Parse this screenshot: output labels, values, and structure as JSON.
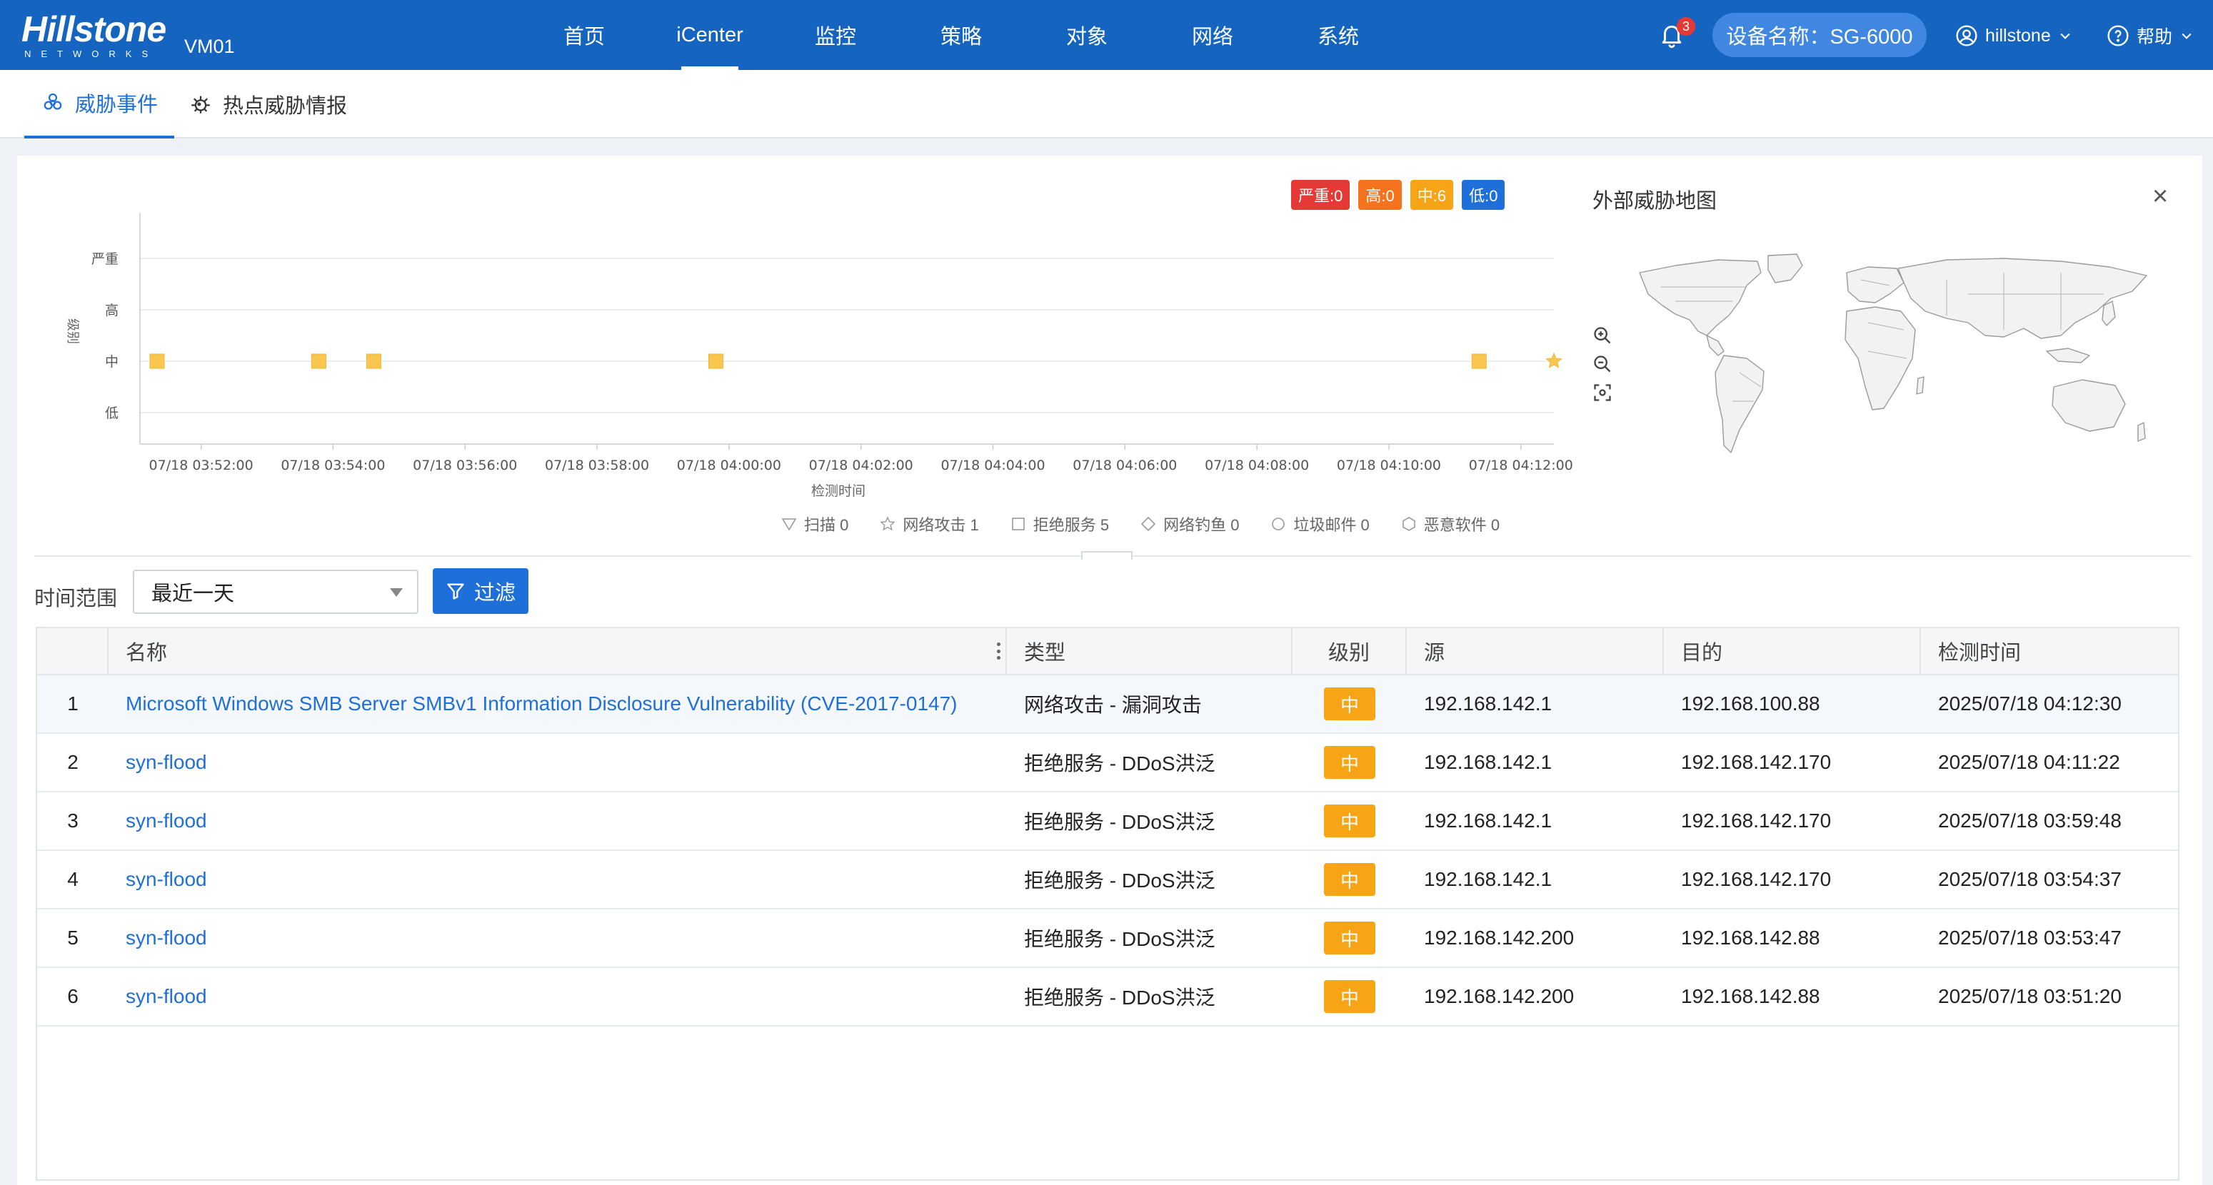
{
  "header": {
    "logo_text": "Hillstone",
    "logo_sub": "NETWORKS",
    "device_short": "VM01",
    "nav": [
      {
        "label": "首页"
      },
      {
        "label": "iCenter"
      },
      {
        "label": "监控"
      },
      {
        "label": "策略"
      },
      {
        "label": "对象"
      },
      {
        "label": "网络"
      },
      {
        "label": "系统"
      }
    ],
    "active_nav": "iCenter",
    "notification_count": "3",
    "device_name": "设备名称：SG-6000",
    "user": "hillstone",
    "help": "帮助",
    "brand_color": "#1565c0"
  },
  "tabs": [
    {
      "label": "威胁事件",
      "icon": "biohazard-icon",
      "active": true
    },
    {
      "label": "热点威胁情报",
      "icon": "virus-icon",
      "active": false
    }
  ],
  "severity_badges": [
    {
      "label": "严重:0",
      "color": "#e53935"
    },
    {
      "label": "高:0",
      "color": "#f4731c"
    },
    {
      "label": "中:6",
      "color": "#f7a416"
    },
    {
      "label": "低:0",
      "color": "#1e6fd9"
    }
  ],
  "chart_data": {
    "type": "scatter",
    "ylabel": "级别",
    "xlabel": "检测时间",
    "y_categories": [
      "低",
      "中",
      "高",
      "严重"
    ],
    "x_ticks": [
      "07/18 03:52:00",
      "07/18 03:54:00",
      "07/18 03:56:00",
      "07/18 03:58:00",
      "07/18 04:00:00",
      "07/18 04:02:00",
      "07/18 04:04:00",
      "07/18 04:06:00",
      "07/18 04:08:00",
      "07/18 04:10:00",
      "07/18 04:12:00"
    ],
    "xlim": [
      "07/18 03:51:20",
      "07/18 04:12:30"
    ],
    "series": [
      {
        "name": "拒绝服务",
        "marker": "square",
        "color": "#f9c74f",
        "points": [
          {
            "x": "07/18 03:51:20",
            "y": "中"
          },
          {
            "x": "07/18 03:53:47",
            "y": "中"
          },
          {
            "x": "07/18 03:54:37",
            "y": "中"
          },
          {
            "x": "07/18 03:59:48",
            "y": "中"
          },
          {
            "x": "07/18 04:11:22",
            "y": "中"
          }
        ]
      },
      {
        "name": "网络攻击",
        "marker": "star",
        "color": "#f9c74f",
        "points": [
          {
            "x": "07/18 04:12:30",
            "y": "中"
          }
        ]
      }
    ],
    "legend": [
      {
        "label": "扫描 0",
        "shape": "triangle-down"
      },
      {
        "label": "网络攻击 1",
        "shape": "star"
      },
      {
        "label": "拒绝服务 5",
        "shape": "square"
      },
      {
        "label": "网络钓鱼 0",
        "shape": "diamond"
      },
      {
        "label": "垃圾邮件 0",
        "shape": "circle"
      },
      {
        "label": "恶意软件 0",
        "shape": "hexagon"
      }
    ]
  },
  "map": {
    "title": "外部威胁地图",
    "close": "×"
  },
  "filter": {
    "label": "时间范围",
    "value": "最近一天",
    "button": "过滤"
  },
  "table": {
    "headers": [
      "名称",
      "类型",
      "级别",
      "源",
      "目的",
      "检测时间"
    ],
    "rows": [
      {
        "idx": "1",
        "name": "Microsoft Windows SMB Server SMBv1 Information Disclosure Vulnerability (CVE-2017-0147)",
        "type": "网络攻击 - 漏洞攻击",
        "level": "中",
        "src": "192.168.142.1",
        "dst": "192.168.100.88",
        "time": "2025/07/18 04:12:30"
      },
      {
        "idx": "2",
        "name": "syn-flood",
        "type": "拒绝服务 - DDoS洪泛",
        "level": "中",
        "src": "192.168.142.1",
        "dst": "192.168.142.170",
        "time": "2025/07/18 04:11:22"
      },
      {
        "idx": "3",
        "name": "syn-flood",
        "type": "拒绝服务 - DDoS洪泛",
        "level": "中",
        "src": "192.168.142.1",
        "dst": "192.168.142.170",
        "time": "2025/07/18 03:59:48"
      },
      {
        "idx": "4",
        "name": "syn-flood",
        "type": "拒绝服务 - DDoS洪泛",
        "level": "中",
        "src": "192.168.142.1",
        "dst": "192.168.142.170",
        "time": "2025/07/18 03:54:37"
      },
      {
        "idx": "5",
        "name": "syn-flood",
        "type": "拒绝服务 - DDoS洪泛",
        "level": "中",
        "src": "192.168.142.200",
        "dst": "192.168.142.88",
        "time": "2025/07/18 03:53:47"
      },
      {
        "idx": "6",
        "name": "syn-flood",
        "type": "拒绝服务 - DDoS洪泛",
        "level": "中",
        "src": "192.168.142.200",
        "dst": "192.168.142.88",
        "time": "2025/07/18 03:51:20"
      }
    ]
  }
}
